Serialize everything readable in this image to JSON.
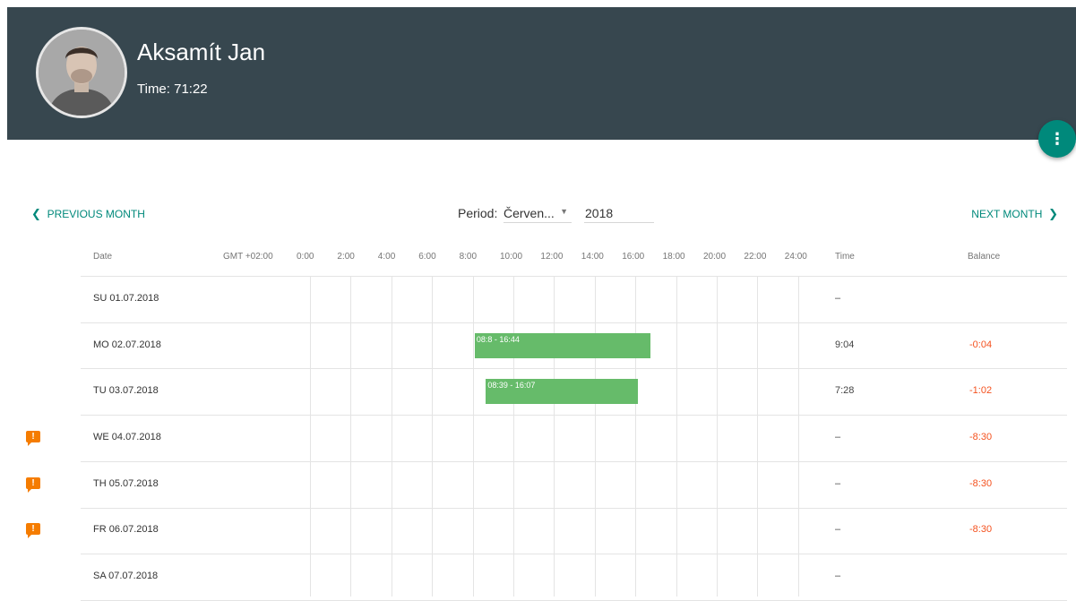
{
  "header": {
    "name": "Aksamít Jan",
    "time_label": "Time: 71:22"
  },
  "fab": {
    "icon": "more-vert-icon",
    "label": "⋮"
  },
  "nav": {
    "prev_label": "PREVIOUS MONTH",
    "next_label": "NEXT MONTH",
    "prev_icon": "chevron-left-icon",
    "next_icon": "chevron-right-icon"
  },
  "period": {
    "label": "Period:",
    "month": "Červen...",
    "year": "2018"
  },
  "table": {
    "col_date": "Date",
    "timezone": "GMT +02:00",
    "hours": [
      "0:00",
      "2:00",
      "4:00",
      "6:00",
      "8:00",
      "10:00",
      "12:00",
      "14:00",
      "16:00",
      "18:00",
      "20:00",
      "22:00",
      "24:00"
    ],
    "col_time": "Time",
    "col_balance": "Balance"
  },
  "rows": [
    {
      "date": "SU 01.07.2018",
      "time": "–",
      "balance": "",
      "warning": false,
      "intervals": []
    },
    {
      "date": "MO 02.07.2018",
      "time": "9:04",
      "balance": "-0:04",
      "warning": false,
      "intervals": [
        {
          "label": "08:8 - 16:44",
          "start": 8.1,
          "end": 16.73
        }
      ]
    },
    {
      "date": "TU 03.07.2018",
      "time": "7:28",
      "balance": "-1:02",
      "warning": false,
      "intervals": [
        {
          "label": "08:39 - 16:07",
          "start": 8.65,
          "end": 16.12
        }
      ]
    },
    {
      "date": "WE 04.07.2018",
      "time": "–",
      "balance": "-8:30",
      "warning": true,
      "intervals": []
    },
    {
      "date": "TH 05.07.2018",
      "time": "–",
      "balance": "-8:30",
      "warning": true,
      "intervals": []
    },
    {
      "date": "FR 06.07.2018",
      "time": "–",
      "balance": "-8:30",
      "warning": true,
      "intervals": []
    },
    {
      "date": "SA 07.07.2018",
      "time": "–",
      "balance": "",
      "warning": false,
      "intervals": []
    }
  ],
  "colors": {
    "header_bg": "#37474f",
    "accent": "#00897b",
    "bar": "#66bb6a",
    "negative": "#f4511e",
    "warning": "#f57c00"
  }
}
